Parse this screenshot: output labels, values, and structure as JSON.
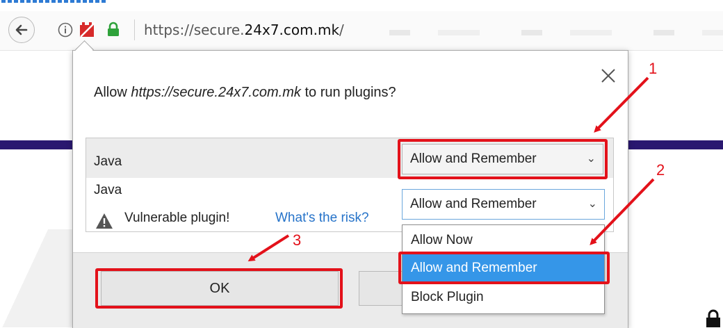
{
  "browser": {
    "url_prefix": "https://secure.",
    "url_domain": "24x7.com.mk",
    "url_suffix": "/"
  },
  "dialog": {
    "prompt_before": "Allow ",
    "prompt_site": "https://secure.24x7.com.mk",
    "prompt_after": " to run plugins?",
    "plugin_rows": [
      {
        "name": "Java",
        "selected_option": "Allow and Remember"
      },
      {
        "name": "Java",
        "selected_option": "Allow and Remember",
        "warning": "Vulnerable plugin!",
        "risk_link": "What's the risk?"
      }
    ],
    "dropdown_options": [
      "Allow Now",
      "Allow and Remember",
      "Block Plugin"
    ],
    "dropdown_highlighted": "Allow and Remember",
    "ok_label": "OK"
  },
  "annotations": {
    "step1": "1",
    "step2": "2",
    "step3": "3",
    "color": "#e3111a"
  }
}
